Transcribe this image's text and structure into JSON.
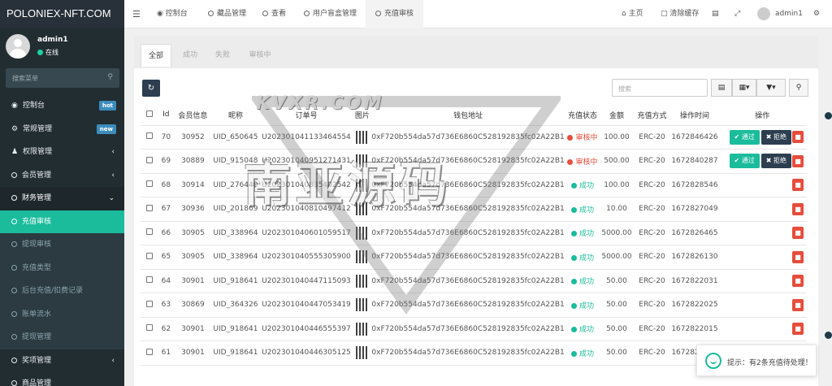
{
  "app": {
    "logo": "POLONIEX-NFT.COM"
  },
  "user": {
    "name": "admin1",
    "status": "在线"
  },
  "sidebar": {
    "search_placeholder": "搜索菜单",
    "items": [
      {
        "label": "控制台",
        "badge": "hot",
        "badge_color": "#3c8dbc"
      },
      {
        "label": "常规管理",
        "badge": "new",
        "badge_color": "#3c8dbc"
      },
      {
        "label": "权限管理"
      },
      {
        "label": "会员管理"
      },
      {
        "label": "财务管理"
      },
      {
        "label": "充值审核"
      },
      {
        "label": "提现审核"
      },
      {
        "label": "充值类型"
      },
      {
        "label": "后台充值/扣费记录"
      },
      {
        "label": "账单流水"
      },
      {
        "label": "提现管理"
      },
      {
        "label": "奖项管理"
      },
      {
        "label": "商品管理"
      }
    ]
  },
  "topbar": {
    "tabs": [
      "控制台",
      "藏品管理",
      "查看",
      "用户盲盒管理",
      "充值审核"
    ],
    "home": "主页",
    "clear_cache": "清除缓存",
    "user": "admin1"
  },
  "content": {
    "tabs": [
      "全部",
      "成功",
      "失败",
      "审核中"
    ],
    "search_placeholder": "搜索",
    "columns": [
      "Id",
      "会员信息",
      "昵称",
      "订单号",
      "图片",
      "钱包地址",
      "充值状态",
      "金额",
      "充值方式",
      "操作时间",
      "操作"
    ],
    "approve_label": "通过",
    "reject_label": "拒绝",
    "rows": [
      {
        "id": "70",
        "member": "30952",
        "nick": "UID_650645",
        "order": "U202301041133464554",
        "wallet": "0xF720b554da57d736E6860C528192835fc02A22B1",
        "status": "审核中",
        "amount": "100.00",
        "method": "ERC-20",
        "time": "1672846426",
        "pending": true
      },
      {
        "id": "69",
        "member": "30889",
        "nick": "UID_915048",
        "order": "U202301040951271431",
        "wallet": "0xF720b554da57d736E6860C528192835fc02A22B1",
        "status": "审核中",
        "amount": "500.00",
        "method": "ERC-20",
        "time": "1672840287",
        "pending": true
      },
      {
        "id": "68",
        "member": "30914",
        "nick": "UID_276440",
        "order": "U202301040835402542",
        "wallet": "0xF720b554da57d736E6860C528192835fc02A22B1",
        "status": "成功",
        "amount": "100.00",
        "method": "ERC-20",
        "time": "1672828546",
        "pending": false
      },
      {
        "id": "67",
        "member": "30936",
        "nick": "UID_201869",
        "order": "U202301040810497412",
        "wallet": "0xF720b554da57d736E6860C528192835fc02A22B1",
        "status": "成功",
        "amount": "10.00",
        "method": "ERC-20",
        "time": "1672827049",
        "pending": false
      },
      {
        "id": "66",
        "member": "30905",
        "nick": "UID_338964",
        "order": "U202301040601059517",
        "wallet": "0xF720b554da57d736E6860C528192835fc02A22B1",
        "status": "成功",
        "amount": "5000.00",
        "method": "ERC-20",
        "time": "1672826465",
        "pending": false
      },
      {
        "id": "65",
        "member": "30905",
        "nick": "UID_338964",
        "order": "U202301040555305900",
        "wallet": "0xF720b554da57d736E6860C528192835fc02A22B1",
        "status": "成功",
        "amount": "5000.00",
        "method": "ERC-20",
        "time": "1672826130",
        "pending": false
      },
      {
        "id": "64",
        "member": "30901",
        "nick": "UID_918641",
        "order": "U202301040447115093",
        "wallet": "0xF720b554da57d736E6860C528192835fc02A22B1",
        "status": "成功",
        "amount": "50.00",
        "method": "ERC-20",
        "time": "1672822031",
        "pending": false
      },
      {
        "id": "63",
        "member": "30869",
        "nick": "UID_364326",
        "order": "U202301040447053419",
        "wallet": "0xF720b554da57d736E6860C528192835fc02A22B1",
        "status": "成功",
        "amount": "50.00",
        "method": "ERC-20",
        "time": "1672822025",
        "pending": false
      },
      {
        "id": "62",
        "member": "30901",
        "nick": "UID_918641",
        "order": "U202301040446555397",
        "wallet": "0xF720b554da57d736E6860C528192835fc02A22B1",
        "status": "成功",
        "amount": "50.00",
        "method": "ERC-20",
        "time": "1672822015",
        "pending": false
      },
      {
        "id": "61",
        "member": "30901",
        "nick": "UID_918641",
        "order": "U202301040446305125",
        "wallet": "0xF720b554da57d736E6860C528192835fc02A22B1",
        "status": "成功",
        "amount": "50.00",
        "method": "ERC-20",
        "time": "1672821915",
        "pending": false
      }
    ]
  },
  "watermark": {
    "line1": "KVXR.COM",
    "line2": "南亚源码"
  },
  "toast": {
    "text": "提示：有2条充值待处理！"
  },
  "colors": {
    "sidebar": "#222d32",
    "active": "#1abc9c",
    "danger": "#e74c3c",
    "success": "#1abc9c",
    "dark": "#2c3e50",
    "pending": "#e74c3c"
  }
}
